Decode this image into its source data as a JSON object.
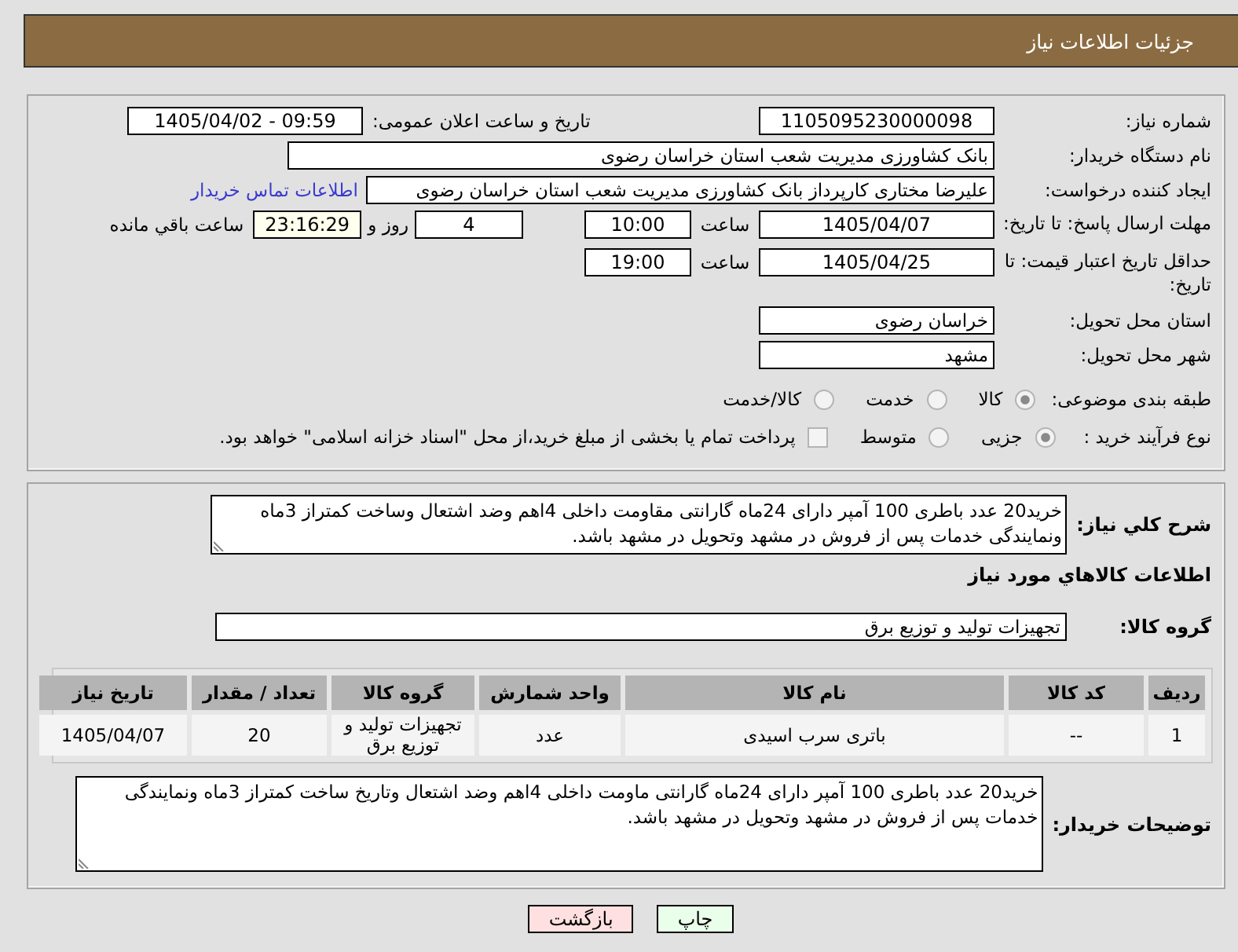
{
  "header": {
    "title": "جزئیات اطلاعات نیاز"
  },
  "need_number": {
    "label": "شماره نیاز:",
    "value": "1105095230000098"
  },
  "announcement": {
    "label": "تاریخ و ساعت اعلان عمومی:",
    "value": "1405/04/02 - 09:59"
  },
  "buyer_org": {
    "label": "نام دستگاه خریدار:",
    "value": "بانک کشاورزی مدیریت شعب استان خراسان رضوی"
  },
  "requester": {
    "label": "ایجاد کننده درخواست:",
    "value": "علیرضا مختاری کارپرداز بانک کشاورزی مدیریت شعب استان خراسان رضوی",
    "contact_link": "اطلاعات تماس خریدار"
  },
  "reply_deadline": {
    "label": "مهلت ارسال پاسخ: تا تاریخ:",
    "date": "1405/04/07",
    "time_label": "ساعت",
    "time": "10:00",
    "days": "4",
    "days_label": "روز و",
    "remaining": "23:16:29",
    "remaining_label": "ساعت باقي مانده"
  },
  "price_validity": {
    "label": "حداقل تاریخ اعتبار قیمت: تا تاریخ:",
    "date": "1405/04/25",
    "time_label": "ساعت",
    "time": "19:00"
  },
  "delivery_province": {
    "label": "استان محل تحویل:",
    "value": "خراسان رضوی"
  },
  "delivery_city": {
    "label": "شهر محل تحویل:",
    "value": "مشهد"
  },
  "category": {
    "label": "طبقه بندی موضوعی:",
    "options": [
      {
        "label": "کالا",
        "selected": true
      },
      {
        "label": "خدمت",
        "selected": false
      },
      {
        "label": "کالا/خدمت",
        "selected": false
      }
    ]
  },
  "purchase_process": {
    "label": "نوع فرآیند خرید :",
    "options": [
      {
        "label": "جزیی",
        "selected": true
      },
      {
        "label": "متوسط",
        "selected": false
      }
    ],
    "treasury_payment": {
      "label": "پرداخت تمام یا بخشی از مبلغ خرید،از محل \"اسناد خزانه اسلامی\" خواهد بود.",
      "checked": false
    }
  },
  "description": {
    "label": "شرح کلي نیاز:",
    "text": "خرید20 عدد باطری 100 آمپر دارای 24ماه گارانتی مقاومت داخلی 4اهم وضد اشتعال وساخت کمتراز 3ماه ونمایندگی خدمات پس از فروش در مشهد وتحویل در مشهد باشد."
  },
  "goods": {
    "heading": "اطلاعات کالاهاي مورد نیاز",
    "group_label": "گروه کالا:",
    "group": "تجهیزات تولید و توزیع برق",
    "table": {
      "columns": [
        "ردیف",
        "کد کالا",
        "نام کالا",
        "واحد شمارش",
        "گروه کالا",
        "تعداد / مقدار",
        "تاریخ نیاز"
      ],
      "rows": [
        [
          "1",
          "--",
          "باتری سرب اسیدی",
          "عدد",
          "تجهیزات تولید و توزیع برق",
          "20",
          "1405/04/07"
        ]
      ]
    }
  },
  "buyer_notes": {
    "label": "توضیحات خریدار:",
    "text": "خرید20 عدد باطری 100 آمپر دارای 24ماه گارانتی ماومت داخلی 4اهم وضد اشتعال وتاریخ ساخت کمتراز 3ماه ونمایندگی خدمات پس از فروش در مشهد وتحویل در مشهد باشد."
  },
  "buttons": [
    {
      "label": "چاپ",
      "kind": "print"
    },
    {
      "label": "بازگشت",
      "kind": "back"
    }
  ]
}
